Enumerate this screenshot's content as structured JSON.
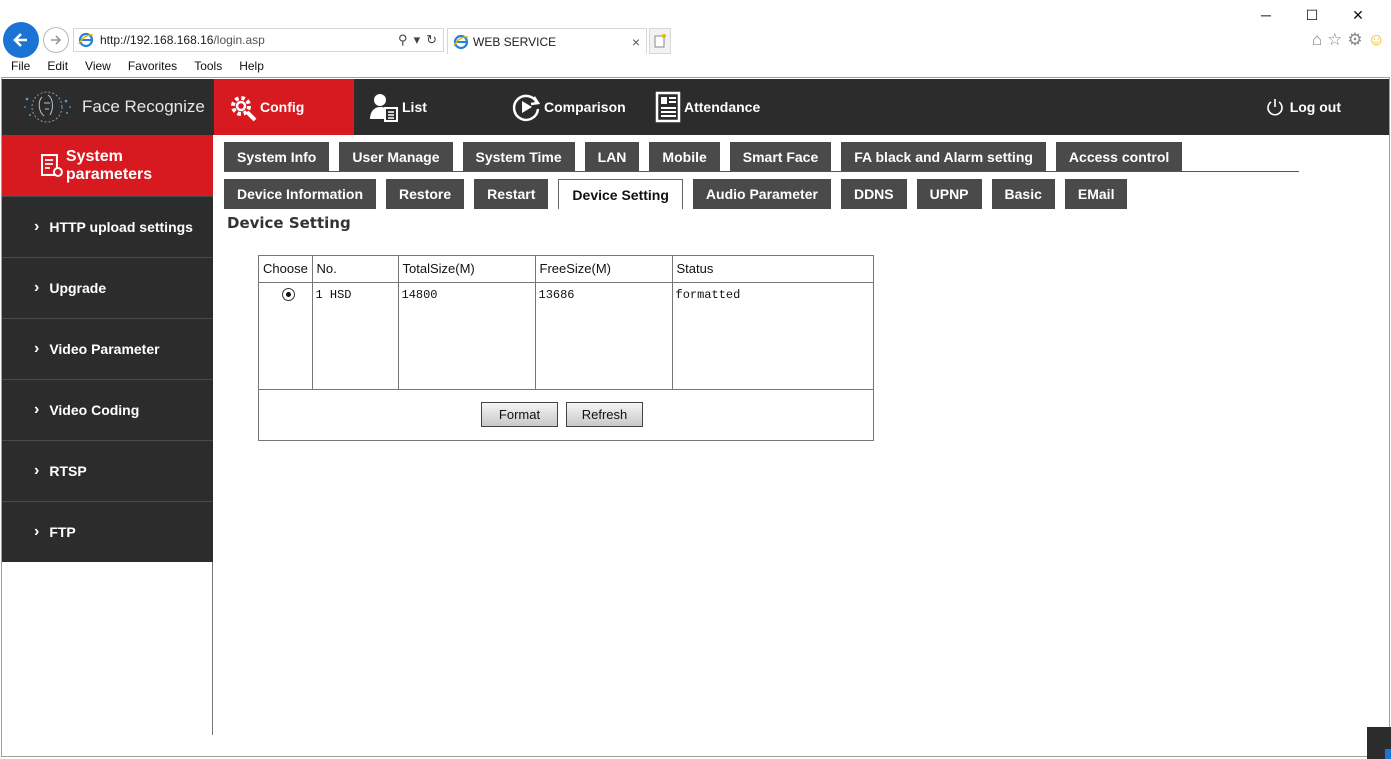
{
  "browser": {
    "url_host": "http://192.168.168.16",
    "url_path": "/login.asp",
    "tab_title": "WEB SERVICE",
    "menu": [
      "File",
      "Edit",
      "View",
      "Favorites",
      "Tools",
      "Help"
    ],
    "window_controls": [
      "─",
      "☐",
      "✕"
    ]
  },
  "app": {
    "brand": "Face Recognize",
    "nav": {
      "config": "Config",
      "list": "List",
      "comparison": "Comparison",
      "attendance": "Attendance",
      "logout": "Log out"
    },
    "sidebar": {
      "header": "System parameters",
      "items": [
        "HTTP upload settings",
        "Upgrade",
        "Video Parameter",
        "Video Coding",
        "RTSP",
        "FTP"
      ]
    },
    "tabs_row1": [
      "System Info",
      "User Manage",
      "System Time",
      "LAN",
      "Mobile",
      "Smart Face",
      "FA black and Alarm setting",
      "Access control"
    ],
    "tabs_row2": [
      "Device Information",
      "Restore",
      "Restart",
      "Device Setting",
      "Audio Parameter",
      "DDNS",
      "UPNP",
      "Basic",
      "EMail"
    ],
    "active_tab": "Device Setting",
    "section_title": "Device Setting",
    "table": {
      "headers": [
        "Choose",
        "No.",
        "TotalSize(M)",
        "FreeSize(M)",
        "Status"
      ],
      "rows": [
        {
          "choose_selected": true,
          "no": "1 HSD",
          "total": "14800",
          "free": "13686",
          "status": "formatted"
        }
      ]
    },
    "buttons": {
      "format": "Format",
      "refresh": "Refresh"
    }
  },
  "colors": {
    "accent_red": "#d71920",
    "nav_dark": "#2c2c2c",
    "tab_gray": "#4a4a4a",
    "browser_blue": "#1b73d3"
  }
}
